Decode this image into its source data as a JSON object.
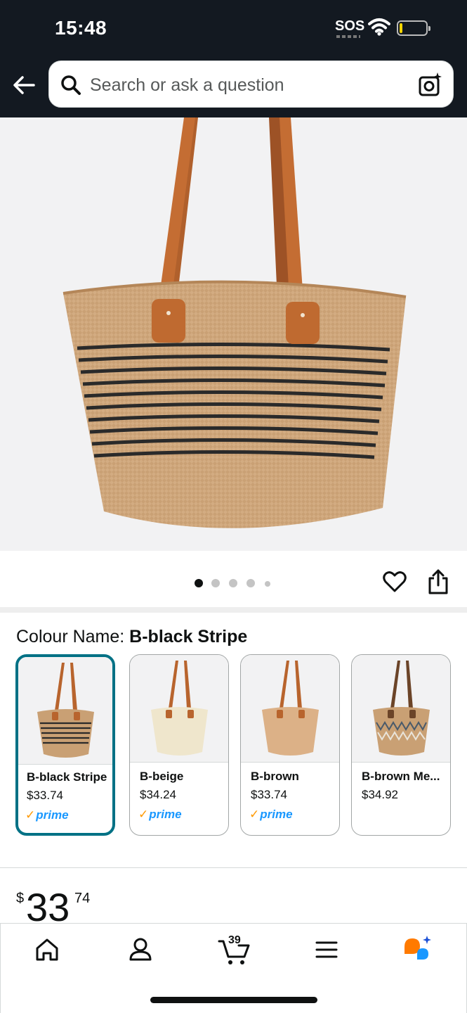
{
  "status_bar": {
    "time": "15:48",
    "sos": "SOS"
  },
  "search": {
    "placeholder": "Search or ask a question"
  },
  "gallery": {
    "image_count": 5,
    "active_index": 0
  },
  "colour": {
    "label": "Colour Name: ",
    "selected": "B-black Stripe",
    "options": [
      {
        "name": "B-black Stripe",
        "price": "$33.74",
        "prime": "prime"
      },
      {
        "name": "B-beige",
        "price": "$34.24",
        "prime": "prime"
      },
      {
        "name": "B-brown",
        "price": "$33.74",
        "prime": "prime"
      },
      {
        "name": "B-brown Me...",
        "price": "$34.92",
        "prime": ""
      }
    ]
  },
  "price": {
    "symbol": "$",
    "whole": "33",
    "fraction": "74"
  },
  "nav": {
    "cart_count": "39"
  },
  "colors": {
    "header_bg": "#131921",
    "selected_border": "#007185",
    "prime_blue": "#1a98ff",
    "prime_check": "#ff9900"
  }
}
